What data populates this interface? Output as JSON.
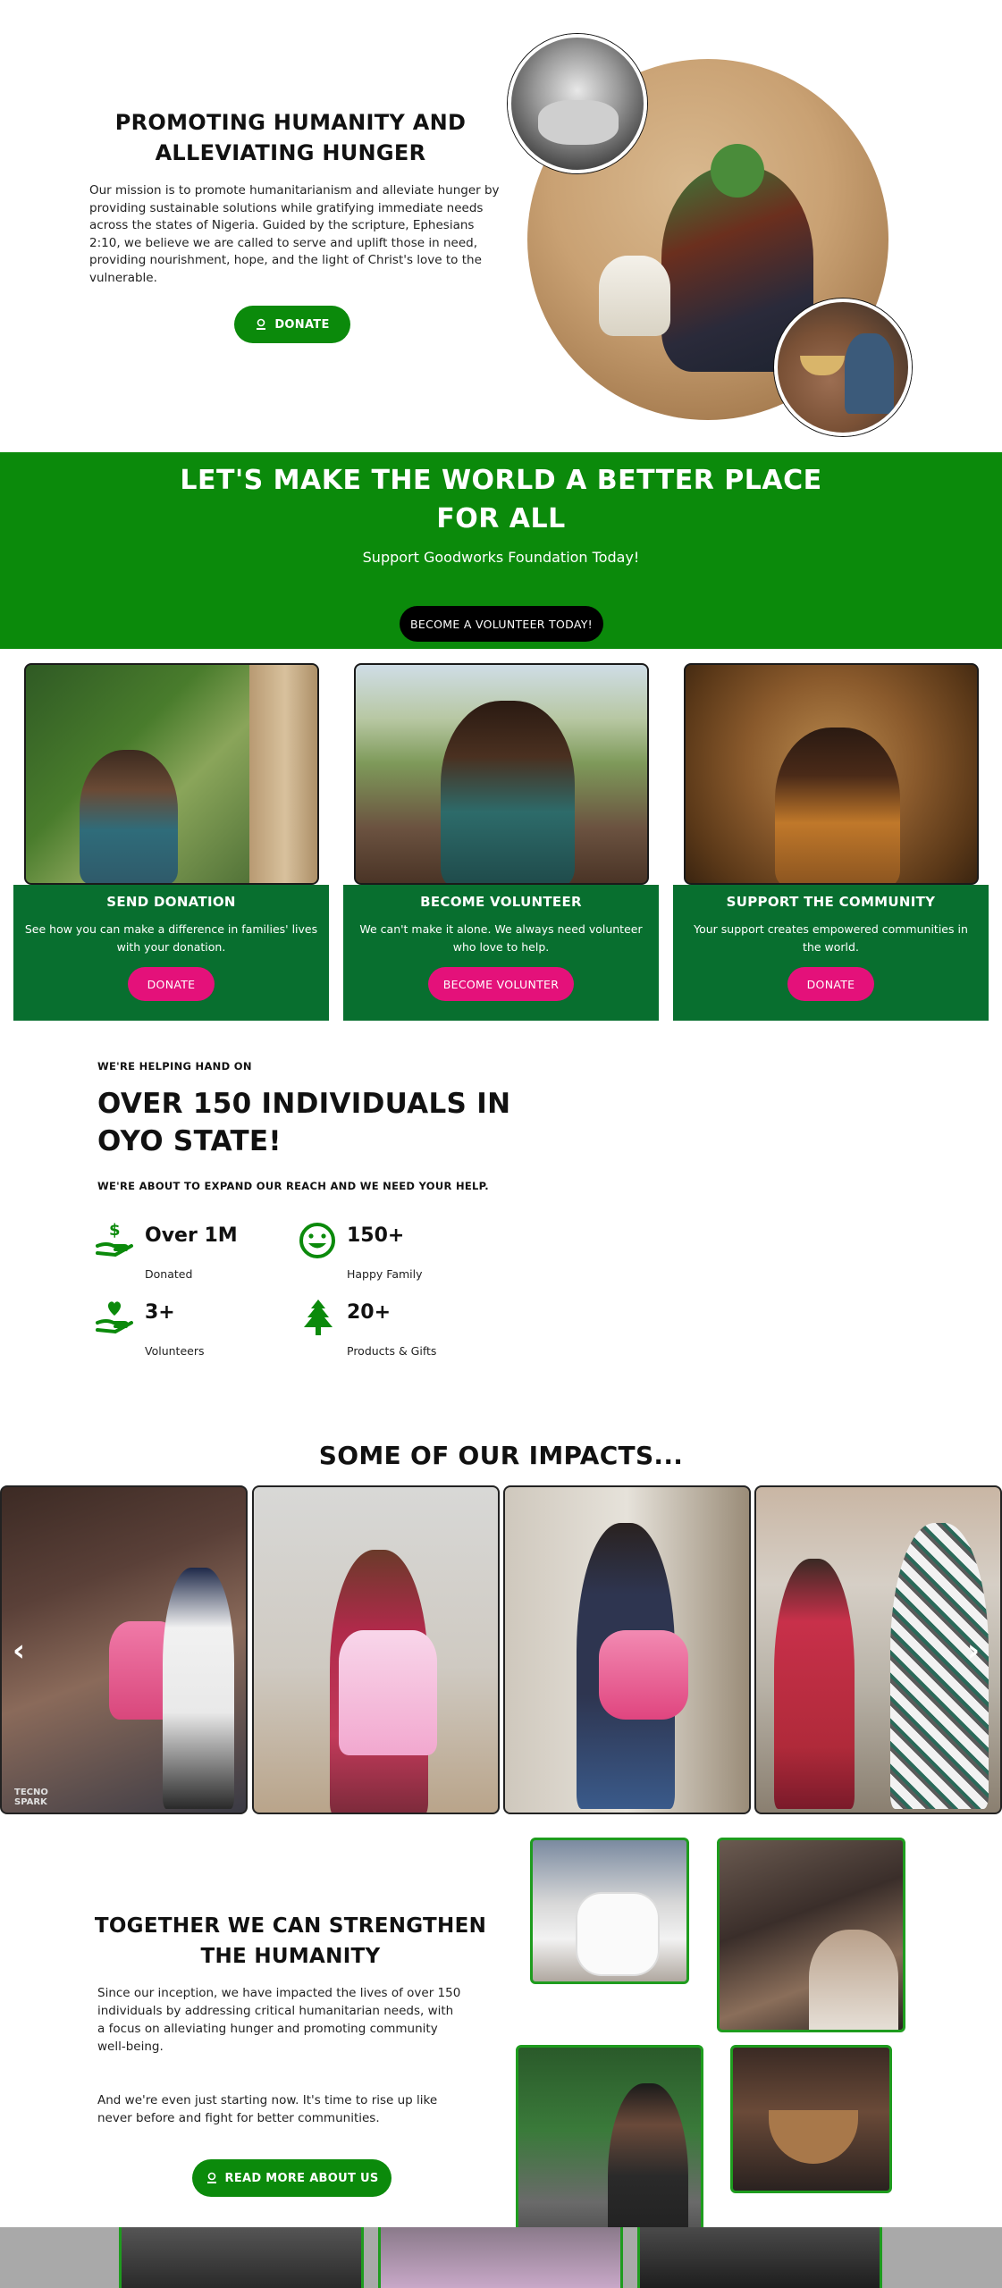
{
  "hero": {
    "title_line1": "PROMOTING HUMANITY AND",
    "title_line2": "ALLEVIATING HUNGER",
    "mission": "Our mission is to promote humanitarianism and alleviate hunger by providing sustainable solutions while gratifying immediate needs across the states of Nigeria. Guided by the scripture, Ephesians 2:10, we believe we are called to serve and uplift those in need, providing nourishment, hope, and the light of Christ's love to the vulnerable.",
    "donate_label": "DONATE"
  },
  "banner": {
    "title_line1": "LET'S MAKE THE WORLD A BETTER PLACE",
    "title_line2": "FOR ALL",
    "subtitle": "Support Goodworks Foundation Today!",
    "cta_label": "BECOME A VOLUNTEER TODAY!"
  },
  "cards": [
    {
      "title": "SEND DONATION",
      "text": "See how you can make a difference in families' lives with your donation.",
      "button": "DONATE"
    },
    {
      "title": "BECOME VOLUNTEER",
      "text": "We can't make it alone. We always need volunteer who love to help.",
      "button": "BECOME VOLUNTER"
    },
    {
      "title": "SUPPORT THE COMMUNITY",
      "text": "Your support creates empowered communities in the world.",
      "button": "DONATE"
    }
  ],
  "stats_section": {
    "eyebrow": "WE'RE HELPING HAND ON",
    "heading_line1": "OVER 150 INDIVIDUALS IN",
    "heading_line2": "OYO STATE!",
    "subheading": "WE'RE ABOUT TO EXPAND OUR REACH AND WE NEED YOUR HELP.",
    "stats": [
      {
        "number": "Over 1M",
        "label": "Donated",
        "icon": "hand-dollar-icon"
      },
      {
        "number": "150+",
        "label": "Happy Family",
        "icon": "smiley-icon"
      },
      {
        "number": "3+",
        "label": "Volunteers",
        "icon": "hand-heart-icon"
      },
      {
        "number": "20+",
        "label": "Products & Gifts",
        "icon": "tree-icon"
      }
    ]
  },
  "impacts": {
    "title": "SOME OF OUR IMPACTS...",
    "watermark_line1": "TECNO",
    "watermark_line2": "SPARK"
  },
  "together": {
    "title_line1": "TOGETHER WE CAN STRENGTHEN",
    "title_line2": "THE HUMANITY",
    "para1": "Since our inception, we have impacted the lives of over 150 individuals by addressing critical humanitarian needs, with a focus on alleviating hunger and promoting community well-being.",
    "para2": "And we're even just starting now.  It's time to rise up like never before and fight for better communities.",
    "button": "READ MORE ABOUT US"
  },
  "colors": {
    "brand_green": "#0b8a0b",
    "card_green": "#086f2f",
    "accent_pink": "#e4117a",
    "gallery_border": "#1e9c1e"
  }
}
